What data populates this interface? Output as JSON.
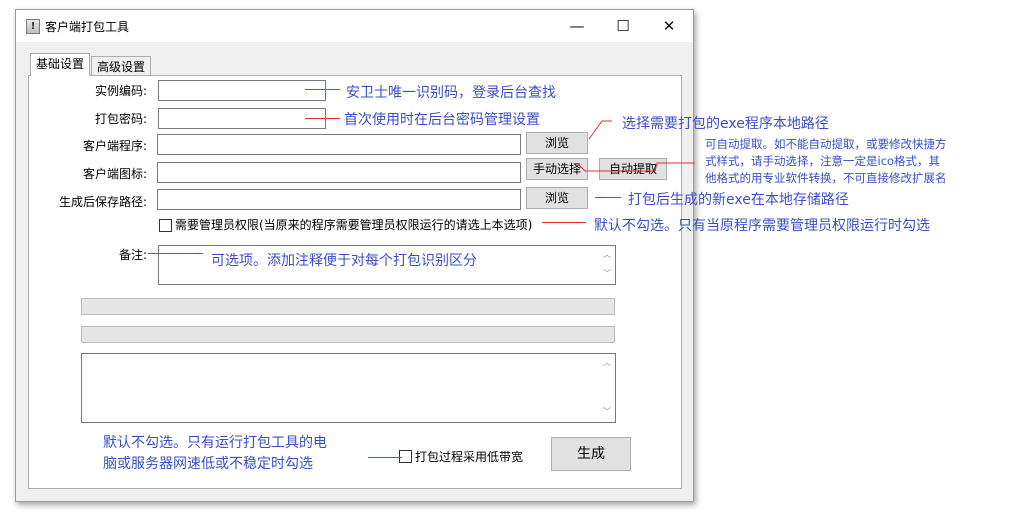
{
  "window": {
    "title": "客户端打包工具",
    "controls": {
      "minimize": "—",
      "maximize": "☐",
      "close": "✕"
    },
    "app_icon_glyph": "!"
  },
  "tabs": [
    {
      "label": "基础设置",
      "active": true
    },
    {
      "label": "高级设置",
      "active": false
    }
  ],
  "form": {
    "instance_code_label": "实例编码:",
    "package_password_label": "打包密码:",
    "client_program_label": "客户端程序:",
    "client_icon_label": "客户端图标:",
    "save_path_label": "生成后保存路径:",
    "browse_label": "浏览",
    "manual_select_label": "手动选择",
    "auto_extract_label": "自动提取",
    "admin_checkbox_label": "需要管理员权限(当原来的程序需要管理员权限运行的请选上本选项)",
    "remark_label": "备注:",
    "low_bandwidth_label": "打包过程采用低带宽",
    "generate_label": "生成"
  },
  "annotations": {
    "instance_code": "安卫士唯一识别码，登录后台查找",
    "password": "首次使用时在后台密码管理设置",
    "program_path": "选择需要打包的exe程序本地路径",
    "icon_lines": [
      "可自动提取。如不能自动提取，或要修改快捷方",
      "式样式，请手动选择，注意一定是ico格式，其",
      "他格式的用专业软件转换，不可直接修改扩展名"
    ],
    "save_path": "打包后生成的新exe在本地存储路径",
    "admin": "默认不勾选。只有当原程序需要管理员权限运行时勾选",
    "remark": "可选项。添加注释便于对每个打包识别区分",
    "bandwidth_lines": [
      "默认不勾选。只有运行打包工具的电",
      "脑或服务器网速低或不稳定时勾选"
    ]
  },
  "colors": {
    "annotation_text": "#3a4fc7",
    "annotation_line": "#e1302a",
    "window_bg": "#f0f0f0"
  }
}
